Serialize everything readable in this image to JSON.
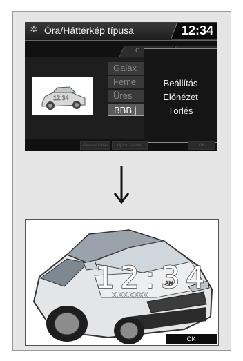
{
  "screen1": {
    "title": "Óra/Háttérkép típusa",
    "clock": "12:34",
    "tab_label": "C",
    "list_items": [
      "Galax",
      "Feme",
      "Üres",
      "BBB.j"
    ],
    "thumb_text": "12:34",
    "popup_items": [
      "Beállítás",
      "Előnézet",
      "Törlés"
    ],
    "bottom_buttons": [
      "Összes törlés",
      "Új hozzáadás",
      "OK"
    ]
  },
  "screen2": {
    "clock": "12:34",
    "ampm": "AM",
    "date": "X.XX.XXXX",
    "ok_label": "OK"
  },
  "colors": {
    "screen_bg": "#111111",
    "panel_bg": "#e5e5e5"
  }
}
